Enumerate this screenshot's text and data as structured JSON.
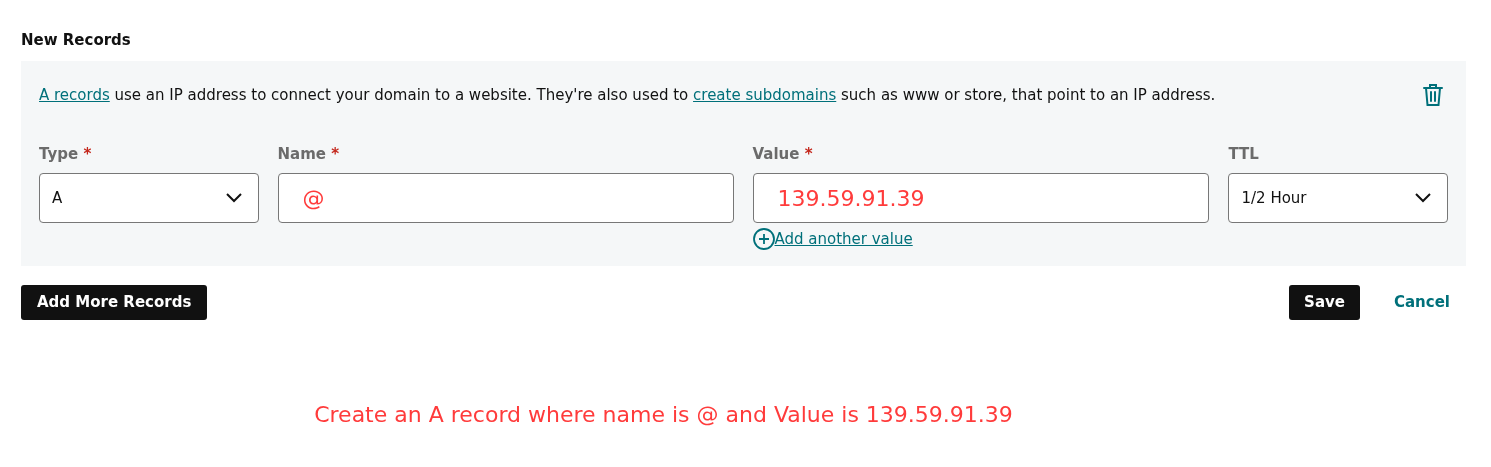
{
  "section_title": "New Records",
  "description": [
    {
      "kind": "link",
      "text": "A records"
    },
    {
      "kind": "text",
      "text": " use an IP address to connect your domain to a website. They're also used to "
    },
    {
      "kind": "link",
      "text": "create subdomains"
    },
    {
      "kind": "text",
      "text": " such as www or store, that point to an IP address."
    }
  ],
  "fields": [
    {
      "kind": "select",
      "label": "Type",
      "required_mark": "*",
      "value": "A"
    },
    {
      "kind": "input",
      "label": "Name",
      "required_mark": "*",
      "value": "@"
    },
    {
      "kind": "input",
      "label": "Value",
      "required_mark": "*",
      "value": "139.59.91.39",
      "add_link": "Add another value"
    },
    {
      "kind": "select",
      "label": "TTL",
      "value": "1/2 Hour"
    }
  ],
  "buttons": {
    "add_more": "Add More Records",
    "save": "Save",
    "cancel": "Cancel"
  },
  "annotation": "Create an A record where name is @ and Value is 139.59.91.39"
}
